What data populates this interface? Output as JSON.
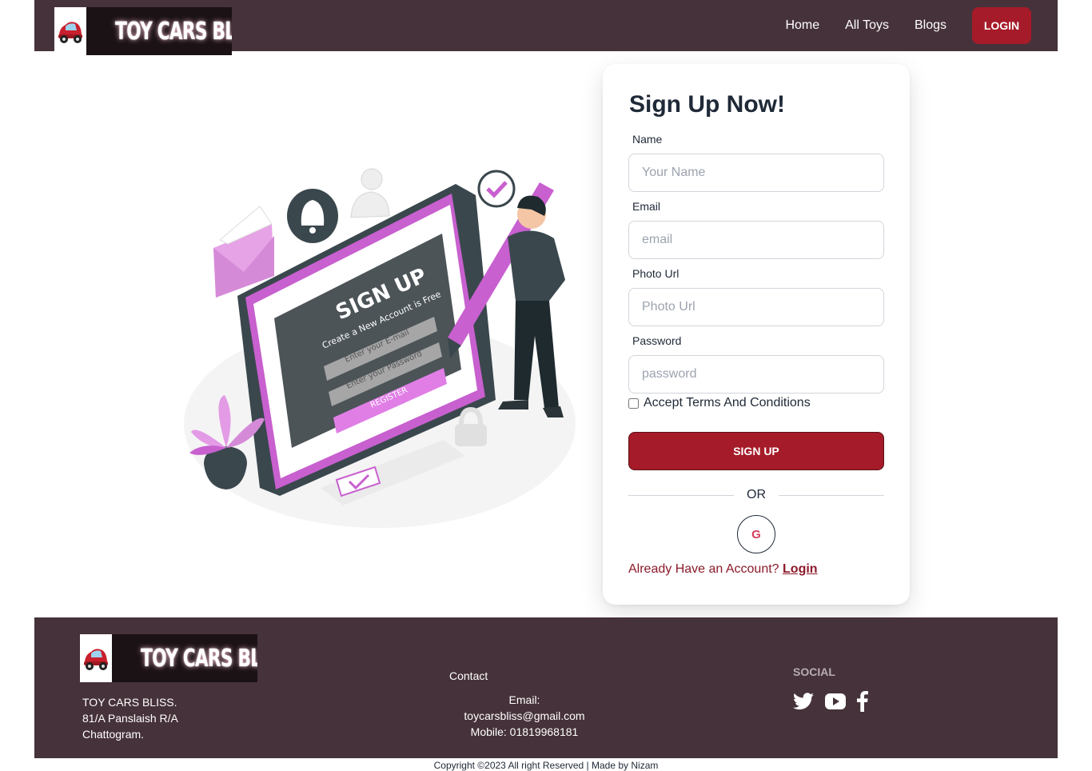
{
  "brand": {
    "name": "TOY CARS BLISS"
  },
  "nav": {
    "items": [
      {
        "label": "Home"
      },
      {
        "label": "All Toys"
      },
      {
        "label": "Blogs"
      }
    ],
    "login_label": "LOGIN"
  },
  "illustration": {
    "heading": "SIGN UP",
    "subheading": "Create a New Account is Free",
    "email_placeholder": "Enter your E-mail",
    "password_placeholder": "Enter your Password",
    "register_label": "REGISTER"
  },
  "signup": {
    "title": "Sign Up Now!",
    "fields": [
      {
        "label": "Name",
        "placeholder": "Your Name",
        "value": ""
      },
      {
        "label": "Email",
        "placeholder": "email",
        "value": ""
      },
      {
        "label": "Photo Url",
        "placeholder": "Photo Url",
        "value": ""
      },
      {
        "label": "Password",
        "placeholder": "password",
        "value": ""
      }
    ],
    "terms_label": "Accept Terms And Conditions",
    "terms_checked": false,
    "submit_label": "SIGN UP",
    "or_label": "OR",
    "google_label": "G",
    "already_text": "Already Have an Account?",
    "login_link": "Login"
  },
  "footer": {
    "address_lines": [
      "TOY CARS BLISS.",
      "81/A Panslaish R/A",
      "Chattogram."
    ],
    "contact_title": "Contact",
    "email": "Email: toycarsbliss@gmail.com",
    "mobile": "Mobile: 01819968181",
    "social_title": "SOCIAL",
    "social_icons": [
      "twitter-icon",
      "youtube-icon",
      "facebook-icon"
    ]
  },
  "copyright": "Copyright ©2023 All right Reserved | Made by Nizam",
  "colors": {
    "header_bg": "#46323a",
    "accent": "#a61b29",
    "link": "#8b1a2a",
    "illustration_accent": "#c860cf"
  }
}
